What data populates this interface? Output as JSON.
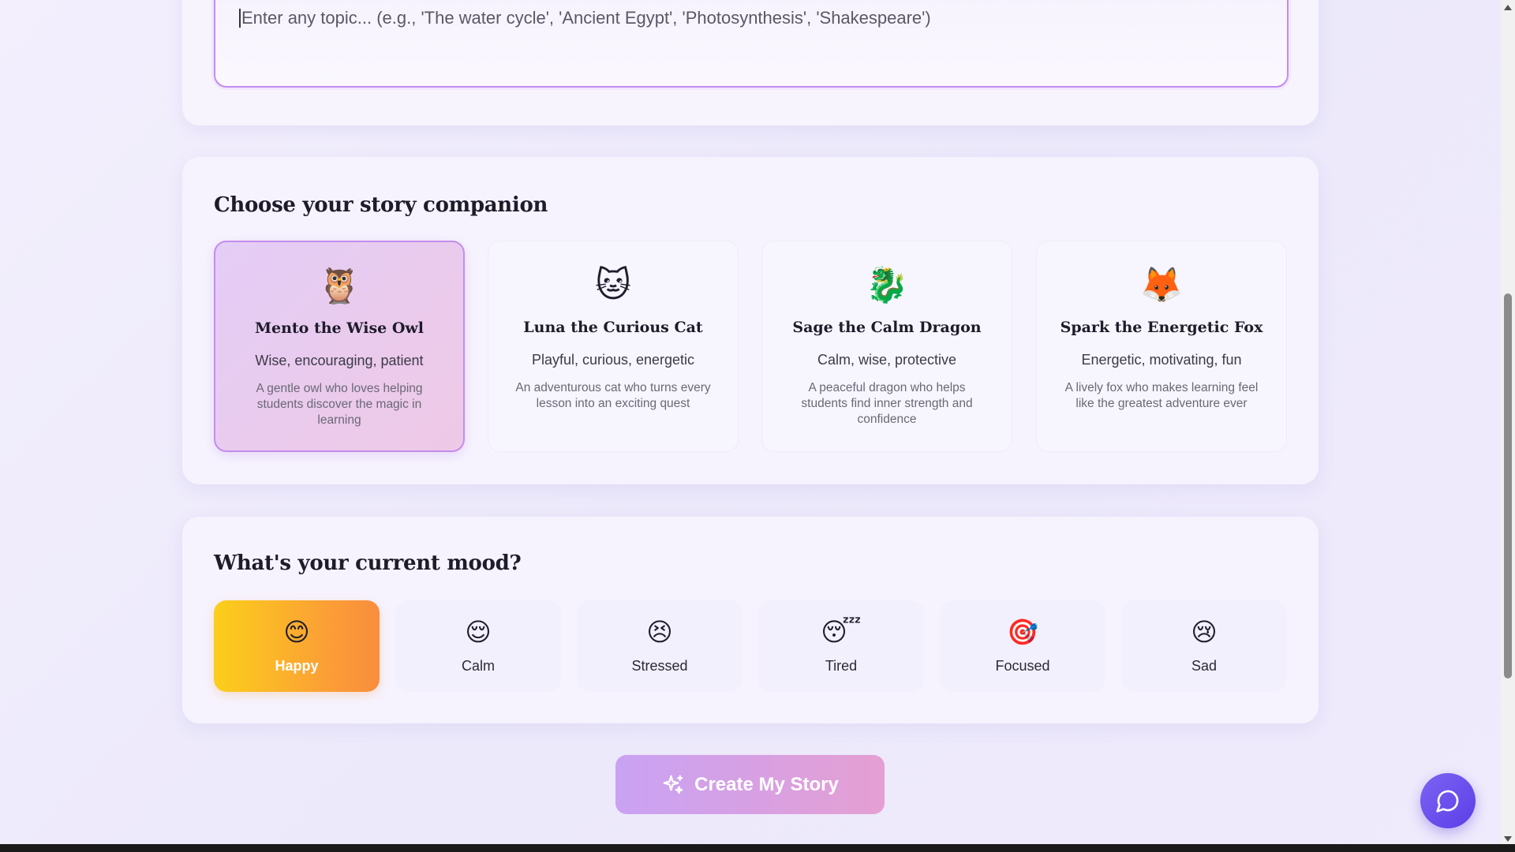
{
  "topic": {
    "placeholder": "Enter any topic... (e.g., 'The water cycle', 'Ancient Egypt', 'Photosynthesis', 'Shakespeare')"
  },
  "companions": {
    "title": "Choose your story companion",
    "items": [
      {
        "emoji": "🦉",
        "name": "Mento the Wise Owl",
        "traits": "Wise, encouraging, patient",
        "desc": "A gentle owl who loves helping students discover the magic in learning",
        "selected": true
      },
      {
        "emoji": "🐱",
        "name": "Luna the Curious Cat",
        "traits": "Playful, curious, energetic",
        "desc": "An adventurous cat who turns every lesson into an exciting quest",
        "selected": false
      },
      {
        "emoji": "🐉",
        "name": "Sage the Calm Dragon",
        "traits": "Calm, wise, protective",
        "desc": "A peaceful dragon who helps students find inner strength and confidence",
        "selected": false
      },
      {
        "emoji": "🦊",
        "name": "Spark the Energetic Fox",
        "traits": "Energetic, motivating, fun",
        "desc": "A lively fox who makes learning feel like the greatest adventure ever",
        "selected": false
      }
    ]
  },
  "mood": {
    "title": "What's your current mood?",
    "items": [
      {
        "emoji": "😊",
        "label": "Happy",
        "selected": true
      },
      {
        "emoji": "😌",
        "label": "Calm",
        "selected": false
      },
      {
        "emoji": "😣",
        "label": "Stressed",
        "selected": false
      },
      {
        "emoji": "😴",
        "label": "Tired",
        "selected": false
      },
      {
        "emoji": "🎯",
        "label": "Focused",
        "selected": false
      },
      {
        "emoji": "😢",
        "label": "Sad",
        "selected": false
      }
    ]
  },
  "create_button": {
    "label": "Create My Story",
    "icon": "sparkles-icon"
  },
  "chat_button": {
    "icon": "chat-bubble-icon"
  },
  "colors": {
    "accent": "#c38bf0",
    "happy_gradient_start": "#fbcf1b",
    "happy_gradient_end": "#fa8d3d",
    "fab": "#6a4ff0"
  }
}
